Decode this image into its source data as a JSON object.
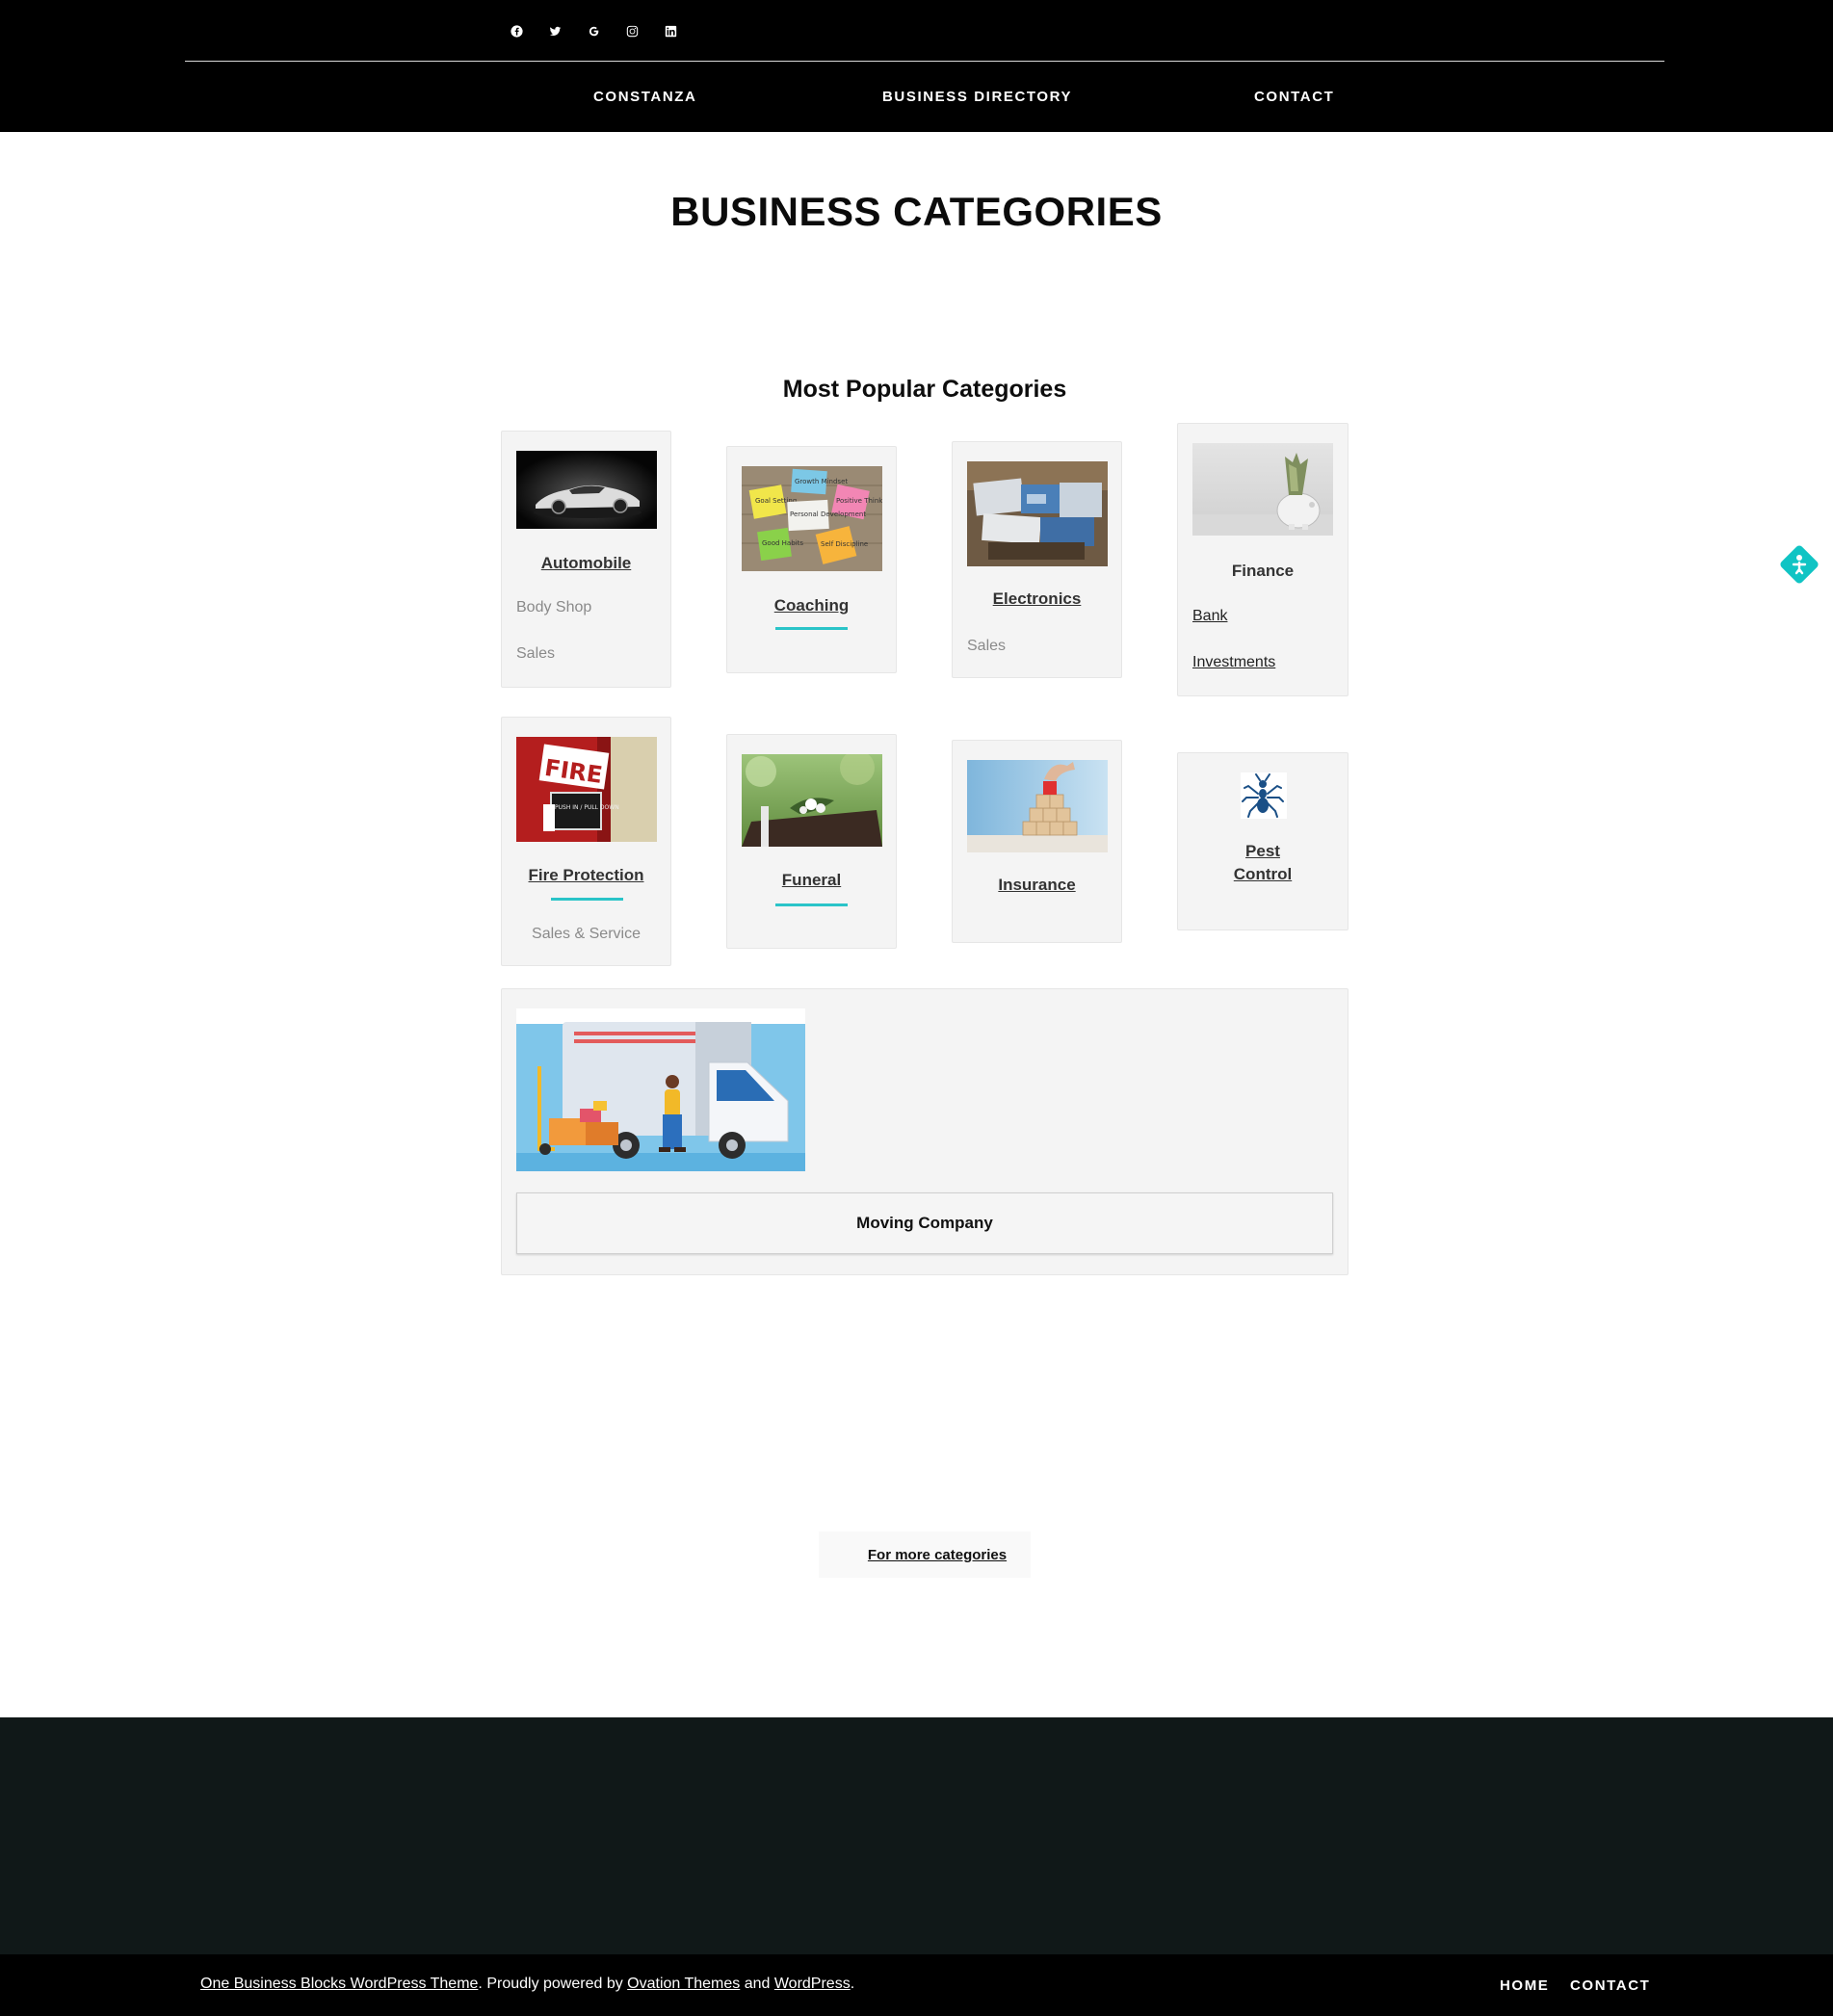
{
  "header": {
    "social_icons": [
      "facebook-icon",
      "twitter-icon",
      "google-icon",
      "instagram-icon",
      "linkedin-icon"
    ],
    "nav": [
      "CONSTANZA",
      "BUSINESS DIRECTORY",
      "CONTACT"
    ]
  },
  "page_title": "BUSINESS CATEGORIES",
  "section_title": "Most Popular Categories",
  "categories": {
    "automobile": {
      "name": "Automobile",
      "subs": [
        "Body Shop",
        "Sales"
      ]
    },
    "coaching": {
      "name": "Coaching",
      "note_texts": [
        "Goal Setting",
        "Growth Mindset",
        "Positive Thinking",
        "Personal Development",
        "Good Habits",
        "Self Discipline"
      ]
    },
    "electronics": {
      "name": "Electronics",
      "subs": [
        "Sales"
      ]
    },
    "finance": {
      "name": "Finance",
      "subs": [
        "Bank",
        "Investments"
      ]
    },
    "fire": {
      "name": "Fire Protection",
      "subs": [
        "Sales & Service"
      ],
      "sign_text": "FIRE",
      "sign_small": "PUSH IN / PULL DOWN"
    },
    "funeral": {
      "name": "Funeral"
    },
    "insurance": {
      "name": "Insurance"
    },
    "pest": {
      "name_line1": "Pest",
      "name_line2": "Control"
    },
    "moving": {
      "name": "Moving Company"
    }
  },
  "more_link": "For more categories",
  "footer": {
    "theme_link": "One Business Blocks WordPress Theme",
    "powered_text": ".  Proudly powered by ",
    "ovation_link": "Ovation Themes",
    "and_text": " and ",
    "wp_link": "WordPress",
    "end_text": ".",
    "nav": [
      "HOME",
      "CONTACT"
    ]
  },
  "colors": {
    "accent": "#2ac4c8",
    "header_bg": "#000000",
    "footer_bg": "#101818",
    "card_bg": "#f4f4f4"
  }
}
